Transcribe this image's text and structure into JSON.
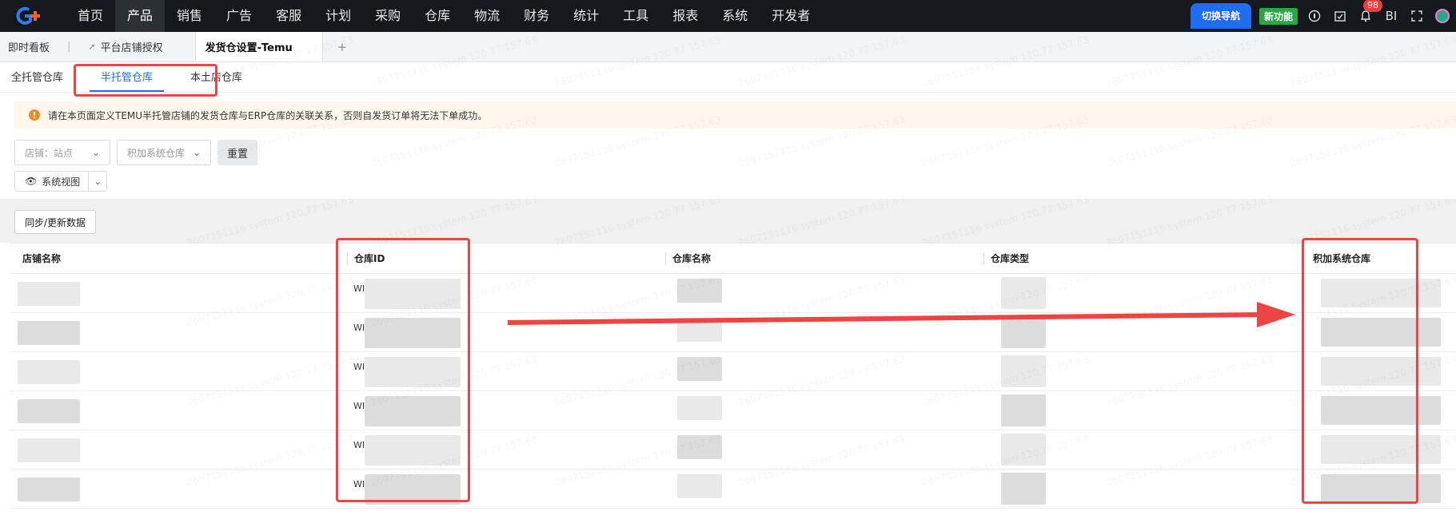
{
  "nav": {
    "items": [
      "首页",
      "产品",
      "销售",
      "广告",
      "客服",
      "计划",
      "采购",
      "仓库",
      "物流",
      "财务",
      "统计",
      "工具",
      "报表",
      "系统",
      "开发者"
    ],
    "active": "产品",
    "switch_label": "切换导航",
    "new_feature_label": "新功能",
    "notification_count": "98",
    "user_initials": "BI"
  },
  "page_tabs": {
    "dashboard": "即时看板",
    "store_auth": "平台店铺授权",
    "active": "发货仓设置-Temu",
    "add": "+"
  },
  "sub_tabs": [
    "全托管仓库",
    "半托管仓库",
    "本土店仓库"
  ],
  "sub_tab_active_index": 1,
  "alert": {
    "icon": "!",
    "text": "请在本页面定义TEMU半托管店铺的发货仓库与ERP仓库的关联关系，否则自发货订单将无法下单成功。"
  },
  "filters": {
    "store_placeholder": "店铺：站点",
    "warehouse_placeholder": "积加系统仓库",
    "reset_label": "重置",
    "view_label": "系统视图"
  },
  "toolbar": {
    "sync_label": "同步/更新数据"
  },
  "table": {
    "columns": [
      "店铺名称",
      "仓库ID",
      "仓库名称",
      "仓库类型",
      "积加系统仓库"
    ],
    "row_prefix": "WI"
  },
  "watermark": "2607151116 system 120.77.157.63",
  "colors": {
    "accent": "#1f6cf5",
    "highlight": "#ef4444",
    "nav_bg": "#15181d",
    "new_badge": "#29a745",
    "alert_bg": "#fff6ec"
  }
}
